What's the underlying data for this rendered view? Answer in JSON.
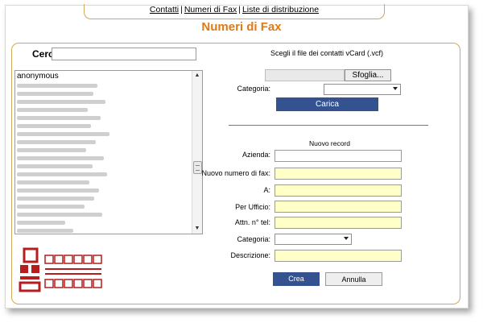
{
  "nav": {
    "contatti": "Contatti",
    "separator": "|",
    "numeri_fax": "Numeri di Fax",
    "liste": "Liste di distribuzione"
  },
  "page_title": "Numeri di Fax",
  "search": {
    "label": "Cerca:",
    "value": ""
  },
  "contacts": {
    "first": "anonymous"
  },
  "import": {
    "label": "Scegli il file dei contatti vCard (.vcf)",
    "browse_label": "Sfoglia...",
    "categoria_label": "Categoria:",
    "categoria_value": "",
    "carica_label": "Carica"
  },
  "new_record": {
    "title": "Nuovo record",
    "azienda_label": "Azienda:",
    "fax_label": "Nuovo numero di fax:",
    "a_label": "A:",
    "ufficio_label": "Per Ufficio:",
    "attn_label": "Attn. n° tel:",
    "categoria_label": "Categoria:",
    "descrizione_label": "Descrizione:",
    "crea_label": "Crea",
    "annulla_label": "Annulla"
  },
  "colors": {
    "accent": "#e07a12",
    "border": "#d2a65a",
    "button_blue": "#34528f",
    "field_yellow": "#ffffc8"
  },
  "icons": [
    "scroll-up-icon",
    "scroll-down-icon",
    "dropdown-caret-icon",
    "logo-icon"
  ]
}
